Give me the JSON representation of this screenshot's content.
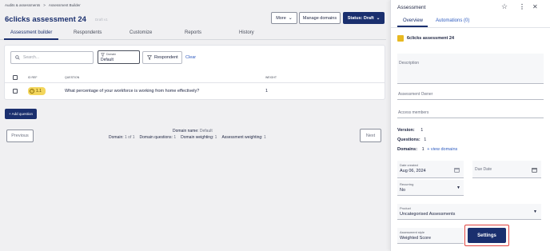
{
  "breadcrumb": {
    "item1": "Audits & assessments",
    "sep": ">",
    "item2": "Assessment Builder"
  },
  "page": {
    "title": "6clicks assessment 24",
    "subtitle": "Draft v1"
  },
  "header_buttons": {
    "more": "More",
    "manage_domains": "Manage domains",
    "status": "Status: Draft"
  },
  "tabs": [
    "Assessment builder",
    "Respondents",
    "Customize",
    "Reports",
    "History"
  ],
  "filters": {
    "search_placeholder": "Search...",
    "domain_label": "Domain",
    "domain_value": "Default",
    "respondent_label": "Respondent",
    "clear_label": "Clear"
  },
  "table": {
    "headers": {
      "id": "ID REF",
      "question": "QUESTION",
      "weight": "WEIGHT"
    },
    "rows": [
      {
        "id": "1.1",
        "question": "What percentage of your workforce is working from home effectively?",
        "weight": "1"
      }
    ]
  },
  "add_question_label": "+ Add question",
  "pagination": {
    "previous": "Previous",
    "next": "Next",
    "domain_name_label": "Domain name:",
    "domain_name_value": "Default",
    "domain_label": "Domain:",
    "domain_value": "1 of 1",
    "questions_label": "Domain questions:",
    "questions_value": "1",
    "weighting_label": "Domain weighting:",
    "weighting_value": "1",
    "assessment_weighting_label": "Assessment weighting:",
    "assessment_weighting_value": "1"
  },
  "panel": {
    "title": "Assessment",
    "tabs": {
      "overview": "Overview",
      "automations": "Automations (0)"
    },
    "name": "6clicks assessment 24",
    "description_label": "Description",
    "owner_label": "Assessment Owner",
    "access_label": "Access members",
    "version_label": "Version:",
    "version_value": "1",
    "questions_label": "Questions:",
    "questions_value": "1",
    "domains_label": "Domains:",
    "domains_value": "1",
    "view_domains": "+ view domains",
    "date_created_label": "Date created",
    "date_created_value": "Aug 06, 2024",
    "due_date_label": "Due Date",
    "recurring_label": "Recurring",
    "recurring_value": "No",
    "product_label": "Product",
    "product_value": "Uncategorised Assessments",
    "style_label": "Assessment style",
    "style_value": "Weighted Score",
    "settings_label": "Settings"
  },
  "colors": {
    "navy": "#1a2f6e",
    "accent": "#e0433f",
    "pill": "#f3d65c"
  }
}
